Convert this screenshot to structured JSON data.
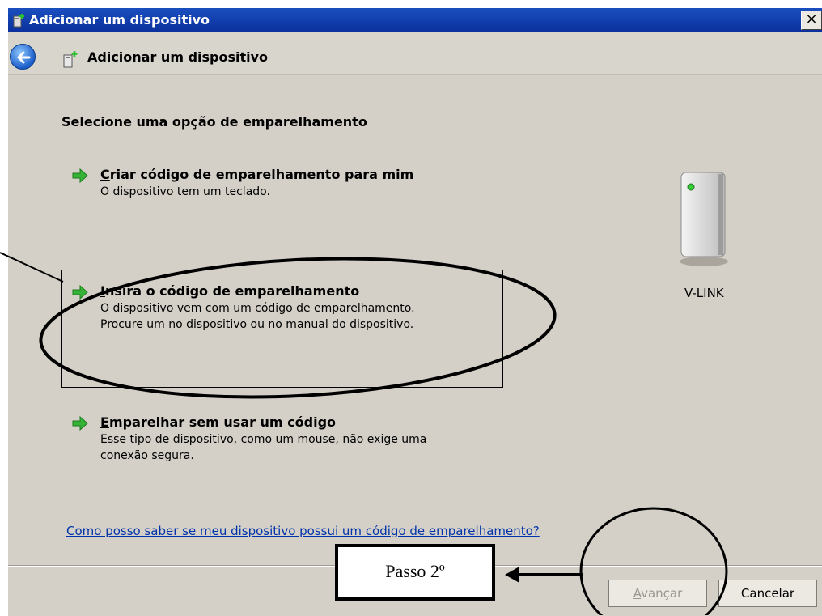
{
  "window": {
    "title": "Adicionar um dispositivo",
    "close_glyph": "×"
  },
  "header": {
    "title": "Adicionar um dispositivo"
  },
  "content": {
    "section_title": "Selecione uma opção de emparelhamento",
    "options": [
      {
        "accesskey": "C",
        "title_rest": "riar código de emparelhamento para mim",
        "desc_line1": "O dispositivo tem um teclado.",
        "desc_line2": ""
      },
      {
        "accesskey": "I",
        "title_rest": "nsira o código de emparelhamento",
        "desc_line1": "O dispositivo vem com um código de emparelhamento.",
        "desc_line2": "Procure um no dispositivo ou no manual do dispositivo."
      },
      {
        "accesskey": "E",
        "title_rest": "mparelhar sem usar um código",
        "desc_line1": "Esse tipo de dispositivo, como um mouse, não exige uma",
        "desc_line2": "conexão segura."
      }
    ],
    "device_label": "V-LINK",
    "help_link": "Como posso saber se meu dispositivo possui um código de emparelhamento?"
  },
  "footer": {
    "next_accesskey": "A",
    "next_rest": "vançar",
    "cancel_label": "Cancelar"
  },
  "annotation": {
    "label": "Passo 2º"
  },
  "icons": {
    "back": "back-arrow-icon",
    "option": "green-arrow-icon",
    "device": "device-tower-icon"
  }
}
